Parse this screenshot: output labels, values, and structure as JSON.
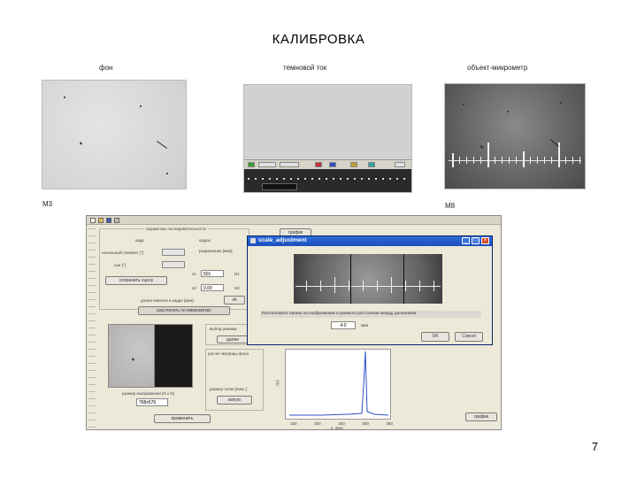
{
  "slide": {
    "title": "КАЛИБРОВКА",
    "captions": {
      "background": "фон",
      "dark": "темновой ток",
      "micrometer": "объект-микрометр"
    },
    "labels": {
      "left_tag": "M3",
      "right_tag": "M8"
    },
    "page_number": "7"
  },
  "app": {
    "toolbar_icons": [
      "new-icon",
      "open-icon",
      "save-icon",
      "print-icon"
    ],
    "top_group_title": "параметры последовательности",
    "labels": {
      "l1": "кадр",
      "l2": "кадры",
      "l3": "начальный элемент [°]",
      "l4": "шаг [°]",
      "l5": "разрешение [мкм]",
      "l6": "размер",
      "x1": "x1",
      "x2": "x2",
      "n1": "N1",
      "n2": "N2",
      "val1": "501",
      "val2": "0.00",
      "calc_label": "длина пиксела в кадре [мкм]",
      "btn_calc": "рассчитать по микрометру",
      "btn_seq": "сохранить сцену",
      "group2": "выбор режима",
      "group3": "расчет матрицы фона",
      "size_label": "размер изображения [N x N]",
      "size_value": "768x576",
      "btn_apply": "применить",
      "btn_ok2": "ok",
      "btn_next": "далее",
      "btn_run": "запуск",
      "right_btn": "график",
      "grid_label": "размер сетки [пикс.]"
    },
    "plot": {
      "ylabel": "I(x)",
      "xlabel": "x, пикс",
      "xticks": [
        "150",
        "200",
        "250",
        "300",
        "350"
      ]
    }
  },
  "dialog": {
    "title": "scale_adjustment",
    "hint": "Расположите линию на изображении и укажите расстояние между делениями",
    "value": "4.0",
    "unit": "мкм",
    "ok": "OK",
    "cancel": "Cancel"
  }
}
